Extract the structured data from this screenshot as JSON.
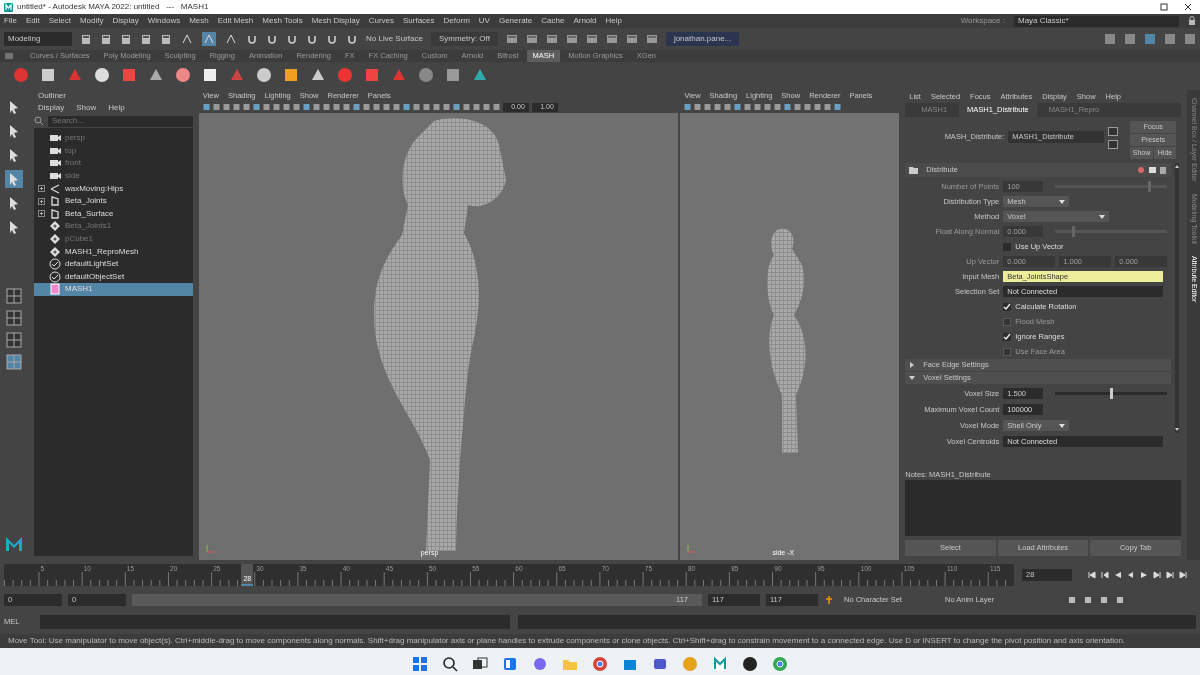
{
  "window": {
    "title": "untitled* - Autodesk MAYA 2022: untitled   ---   MASH1"
  },
  "menubar": {
    "items": [
      "File",
      "Edit",
      "Select",
      "Modify",
      "Display",
      "Windows",
      "Mesh",
      "Edit Mesh",
      "Mesh Tools",
      "Mesh Display",
      "Curves",
      "Surfaces",
      "Deform",
      "UV",
      "Generate",
      "Cache",
      "Arnold",
      "Help"
    ],
    "workspace_label": "Workspace :",
    "workspace": "Maya Classic*"
  },
  "status_line": {
    "menu_set": "Modeling",
    "live_surface": "No Live Surface",
    "symmetry": "Symmetry: Off",
    "user": "jonathan.pane..."
  },
  "shelf_tabs": [
    {
      "label": "Curves / Surfaces",
      "selected": false
    },
    {
      "label": "Poly Modeling",
      "selected": false
    },
    {
      "label": "Sculpting",
      "selected": false
    },
    {
      "label": "Rigging",
      "selected": false
    },
    {
      "label": "Animation",
      "selected": false
    },
    {
      "label": "Rendering",
      "selected": false
    },
    {
      "label": "FX",
      "selected": false
    },
    {
      "label": "FX Caching",
      "selected": false
    },
    {
      "label": "Custom",
      "selected": false
    },
    {
      "label": "Arnold",
      "selected": false
    },
    {
      "label": "Bifrost",
      "selected": false
    },
    {
      "label": "MASH",
      "selected": true
    },
    {
      "label": "Motion Graphics",
      "selected": false
    },
    {
      "label": "XGen",
      "selected": false
    }
  ],
  "outliner": {
    "title": "Outliner",
    "menu": [
      "Display",
      "Show",
      "Help"
    ],
    "search": {
      "placeholder": "Search..."
    },
    "items": [
      {
        "kind": "camera",
        "label": "persp",
        "hidden": true,
        "selected": false
      },
      {
        "kind": "camera",
        "label": "top",
        "hidden": true,
        "selected": false
      },
      {
        "kind": "camera",
        "label": "front",
        "hidden": true,
        "selected": false
      },
      {
        "kind": "camera",
        "label": "side",
        "hidden": true,
        "selected": false
      },
      {
        "kind": "joint",
        "label": "waxMoving:Hips",
        "hidden": false,
        "expanded": false,
        "selected": false
      },
      {
        "kind": "mesh",
        "label": "Beta_Joints",
        "hidden": false,
        "expanded": false,
        "selected": false
      },
      {
        "kind": "mesh",
        "label": "Beta_Surface",
        "hidden": false,
        "expanded": false,
        "selected": false
      },
      {
        "kind": "transform",
        "label": "Beta_Joints1",
        "hidden": true,
        "selected": false
      },
      {
        "kind": "transform",
        "label": "pCube1",
        "hidden": true,
        "selected": false
      },
      {
        "kind": "transform",
        "label": "MASH1_ReproMesh",
        "hidden": false,
        "selected": false
      },
      {
        "kind": "set",
        "label": "defaultLightSet",
        "hidden": false,
        "selected": false
      },
      {
        "kind": "set",
        "label": "defaultObjectSet",
        "hidden": false,
        "selected": false
      },
      {
        "kind": "mash",
        "label": "MASH1",
        "hidden": false,
        "selected": true
      }
    ]
  },
  "viewports": [
    {
      "menu": [
        "View",
        "Shading",
        "Lighting",
        "Show",
        "Renderer",
        "Panels"
      ],
      "fields": [
        "0.00",
        "1.00"
      ],
      "label": "persp"
    },
    {
      "menu": [
        "View",
        "Shading",
        "Lighting",
        "Show",
        "Renderer",
        "Panels"
      ],
      "label": "side -X"
    }
  ],
  "attribute_editor": {
    "menu": [
      "List",
      "Selected",
      "Focus",
      "Attributes",
      "Display",
      "Show",
      "Help"
    ],
    "tabs": [
      {
        "label": "MASH1",
        "selected": false
      },
      {
        "label": "MASH1_Distribute",
        "selected": true
      },
      {
        "label": "MASH1_Repro",
        "selected": false
      }
    ],
    "node_label": "MASH_Distribute:",
    "node_name": "MASH1_Distribute",
    "buttons": [
      "Focus",
      "Presets",
      "Show",
      "Hide"
    ],
    "section": "Distribute",
    "rows": [
      {
        "kind": "slider",
        "label": "Number of Points",
        "value": "100",
        "level": 0.85,
        "disabled": true
      },
      {
        "kind": "dropdown",
        "label": "Distribution Type",
        "value": "Mesh",
        "disabled": false
      },
      {
        "kind": "dropdown",
        "label": "Method",
        "value": "Voxel",
        "disabled": false,
        "wide": true
      },
      {
        "kind": "slider",
        "label": "Float Along Normal",
        "value": "0.000",
        "level": 0.15,
        "disabled": true
      },
      {
        "kind": "checkbox",
        "label": "Use Up Vector",
        "checked": false,
        "disabled": false
      },
      {
        "kind": "vector",
        "label": "Up Vector",
        "values": [
          "0.000",
          "1.000",
          "0.000"
        ],
        "disabled": true
      },
      {
        "kind": "field",
        "label": "Input Mesh",
        "value": "Beta_JointsShape",
        "highlight": true,
        "disabled": false
      },
      {
        "kind": "field",
        "label": "Selection Set",
        "value": "Not Connected",
        "highlight": false,
        "disabled": false
      },
      {
        "kind": "checkbox",
        "label": "Calculate Rotation",
        "checked": true,
        "disabled": false
      },
      {
        "kind": "checkbox",
        "label": "Flood Mesh",
        "checked": false,
        "disabled": true
      },
      {
        "kind": "checkbox",
        "label": "Ignore Ranges",
        "checked": true,
        "disabled": false
      },
      {
        "kind": "checkbox",
        "label": "Use Face Area",
        "checked": false,
        "disabled": true
      }
    ],
    "frames": [
      {
        "label": "Face Edge Settings",
        "expanded": false
      },
      {
        "label": "Voxel Settings",
        "expanded": true,
        "rows": [
          {
            "kind": "slider",
            "label": "Voxel Size",
            "value": "1.500",
            "level": 0.5,
            "disabled": false
          },
          {
            "kind": "field",
            "label": "Maximum Voxel Count",
            "value": "100000",
            "highlight": false,
            "short": true,
            "disabled": false
          },
          {
            "kind": "dropdown",
            "label": "Voxel Mode",
            "value": "Shell Only",
            "disabled": false
          },
          {
            "kind": "field",
            "label": "Voxel Centroids",
            "value": "Not Connected",
            "highlight": false,
            "disabled": false
          }
        ]
      }
    ],
    "notes_label": "Notes:  MASH1_Distribute",
    "bottom_buttons": [
      "Select",
      "Load Attributes",
      "Copy Tab"
    ]
  },
  "side_tabs": [
    {
      "label": "Channel Box / Layer Editor",
      "selected": false
    },
    {
      "label": "Modeling Toolkit",
      "selected": false
    },
    {
      "label": "Attribute Editor",
      "selected": true
    }
  ],
  "timeline": {
    "frame_labels": [
      "5",
      "10",
      "15",
      "20",
      "25",
      "30",
      "35",
      "40",
      "45",
      "50",
      "55",
      "60",
      "65",
      "70",
      "75",
      "80",
      "85",
      "90",
      "95",
      "100",
      "105",
      "110",
      "115"
    ],
    "playhead": {
      "label": "28",
      "level": 0.235
    },
    "current_frame": "28"
  },
  "range": {
    "start": "0",
    "playback_start": "0",
    "slider": {
      "label": "117",
      "level": 1
    },
    "playback_end": "117",
    "end": "117",
    "character_set": "No Character Set",
    "anim_layer": "No Anim Layer"
  },
  "command_line": {
    "label": "MEL"
  },
  "help_line": "Move Tool: Use manipulator to move object(s). Ctrl+middle-drag to move components along normals. Shift+drag manipulator axis or plane handles to extrude components or clone objects. Ctrl+Shift+drag to constrain movement to a connected edge. Use D or INSERT to change the pivot position and axis orientation."
}
